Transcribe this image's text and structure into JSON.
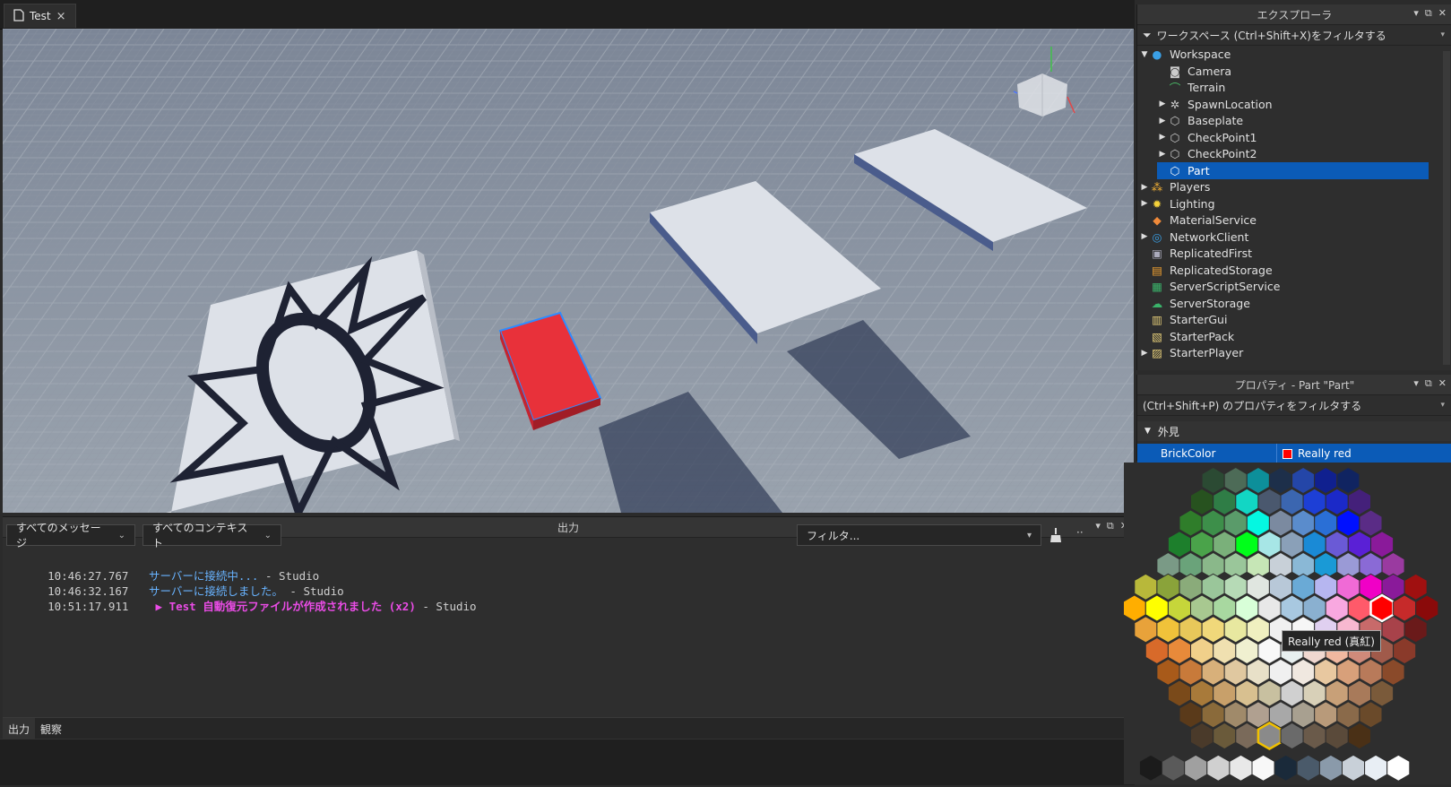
{
  "doc_tab": {
    "title": "Test",
    "close": "×"
  },
  "explorer": {
    "title": "エクスプローラ",
    "filter_placeholder": "ワークスペース (Ctrl+Shift+X)をフィルタする",
    "items": [
      {
        "label": "Workspace",
        "icon": "workspace-icon",
        "expanded": true
      },
      {
        "label": "Camera",
        "icon": "camera-icon"
      },
      {
        "label": "Terrain",
        "icon": "terrain-icon"
      },
      {
        "label": "SpawnLocation",
        "icon": "spawn-icon"
      },
      {
        "label": "Baseplate",
        "icon": "part-icon"
      },
      {
        "label": "CheckPoint1",
        "icon": "part-icon"
      },
      {
        "label": "CheckPoint2",
        "icon": "part-icon"
      },
      {
        "label": "Part",
        "icon": "part-icon",
        "selected": true
      },
      {
        "label": "Players",
        "icon": "players-icon"
      },
      {
        "label": "Lighting",
        "icon": "lighting-icon"
      },
      {
        "label": "MaterialService",
        "icon": "material-icon"
      },
      {
        "label": "NetworkClient",
        "icon": "network-icon"
      },
      {
        "label": "ReplicatedFirst",
        "icon": "replicated-first-icon"
      },
      {
        "label": "ReplicatedStorage",
        "icon": "replicated-storage-icon"
      },
      {
        "label": "ServerScriptService",
        "icon": "server-script-icon"
      },
      {
        "label": "ServerStorage",
        "icon": "server-storage-icon"
      },
      {
        "label": "StarterGui",
        "icon": "starter-gui-icon"
      },
      {
        "label": "StarterPack",
        "icon": "starter-pack-icon"
      },
      {
        "label": "StarterPlayer",
        "icon": "starter-player-icon"
      }
    ]
  },
  "properties": {
    "title": "プロパティ - Part \"Part\"",
    "filter_placeholder": "(Ctrl+Shift+P) のプロパティをフィルタする",
    "category": "外見",
    "rows": [
      {
        "name": "BrickColor",
        "value": "Really red",
        "color": "#ff0000"
      }
    ]
  },
  "output": {
    "title": "出力",
    "message_filter": "すべてのメッセージ",
    "context_filter": "すべてのコンテキスト",
    "search_placeholder": "フィルタ...",
    "logs": [
      {
        "time": "10:46:27.767",
        "message": "サーバーに接続中...",
        "sep": " - ",
        "source": "Studio",
        "style": "blue"
      },
      {
        "time": "10:46:32.167",
        "message": "サーバーに接続しました。",
        "sep": " - ",
        "source": "Studio",
        "style": "blue"
      },
      {
        "time": "10:51:17.911",
        "message": "▶ Test 自動復元ファイルが作成されました (x2)",
        "sep": " - ",
        "source": "Studio",
        "style": "magenta"
      }
    ],
    "tabs": [
      "出力",
      "観察"
    ]
  },
  "tooltip": "Really red (真紅)",
  "colors": {
    "selection": "#0b5bb7",
    "red_part": "#e8313a",
    "accent_blue": "#68b3ff"
  }
}
